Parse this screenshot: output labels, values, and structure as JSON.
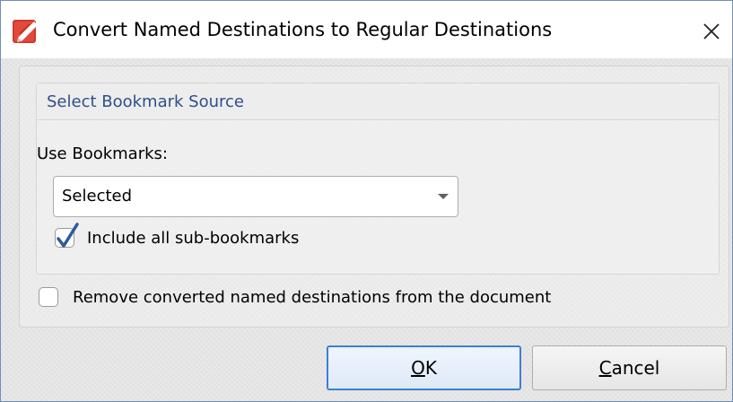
{
  "window": {
    "title": "Convert Named Destinations to Regular Destinations",
    "app_icon": "pdf-xchange-editor-icon",
    "close_icon": "close-icon"
  },
  "group": {
    "title": "Select Bookmark Source",
    "use_bookmarks_label": "Use Bookmarks:",
    "dropdown": {
      "selected": "Selected",
      "icon": "chevron-down-icon"
    },
    "include_sub_bookmarks": {
      "label": "Include all sub-bookmarks",
      "checked": true
    }
  },
  "remove_converted": {
    "label": "Remove converted named destinations from the document",
    "checked": false
  },
  "buttons": {
    "ok": {
      "mnemonic": "O",
      "rest": "K"
    },
    "cancel": {
      "mnemonic": "C",
      "rest": "ancel"
    }
  },
  "colors": {
    "group_title": "#2e4f8a",
    "default_button_border": "#3c7fd4",
    "checkmark": "#2b5b9a"
  }
}
